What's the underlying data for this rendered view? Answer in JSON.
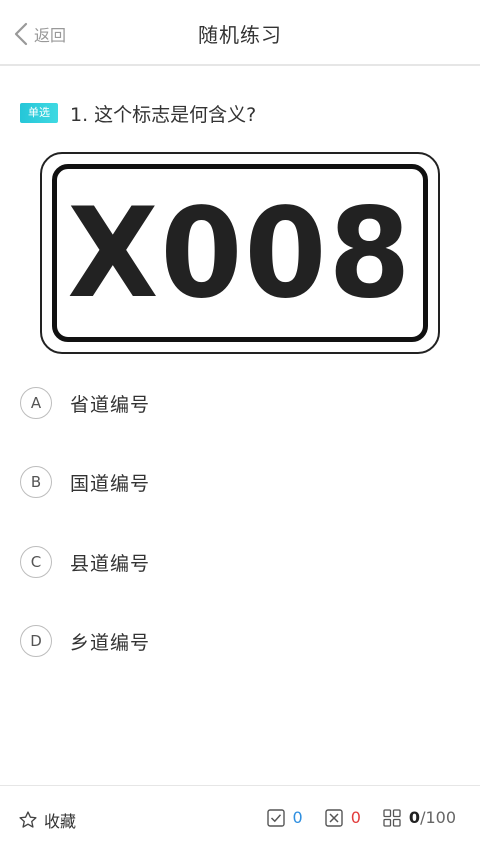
{
  "header": {
    "back_label": "返回",
    "title": "随机练习"
  },
  "question": {
    "type_badge": "单选",
    "text": "1. 这个标志是何含义?",
    "sign_text": "X008"
  },
  "options": [
    {
      "letter": "A",
      "text": "省道编号"
    },
    {
      "letter": "B",
      "text": "国道编号"
    },
    {
      "letter": "C",
      "text": "县道编号"
    },
    {
      "letter": "D",
      "text": "乡道编号"
    }
  ],
  "footer": {
    "favorite_label": "收藏",
    "correct_count": "0",
    "wrong_count": "0",
    "done_count": "0",
    "total_label": "/100"
  },
  "colors": {
    "badge": "#25c6d8",
    "correct": "#2f8fe0",
    "wrong": "#e23c3c"
  }
}
